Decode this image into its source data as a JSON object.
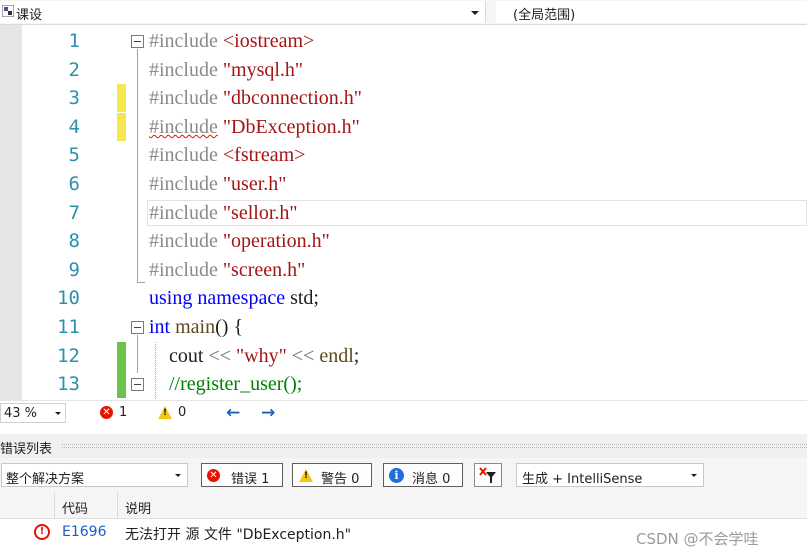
{
  "navbar": {
    "project": "课设",
    "scope": "(全局范围)"
  },
  "editor": {
    "lines": [
      {
        "num": "1",
        "parts": [
          {
            "t": "#include ",
            "c": "pp"
          },
          {
            "t": "<iostream>",
            "c": "str"
          }
        ]
      },
      {
        "num": "2",
        "parts": [
          {
            "t": "#include ",
            "c": "pp"
          },
          {
            "t": "\"mysql.h\"",
            "c": "str"
          }
        ]
      },
      {
        "num": "3",
        "parts": [
          {
            "t": "#include ",
            "c": "pp"
          },
          {
            "t": "\"dbconnection.h\"",
            "c": "str"
          }
        ]
      },
      {
        "num": "4",
        "parts": [
          {
            "t": "#include",
            "c": "pp squiggle"
          },
          {
            "t": " ",
            "c": "pp"
          },
          {
            "t": "\"DbException.h\"",
            "c": "str"
          }
        ]
      },
      {
        "num": "5",
        "parts": [
          {
            "t": "#include ",
            "c": "pp"
          },
          {
            "t": "<fstream>",
            "c": "str"
          }
        ]
      },
      {
        "num": "6",
        "parts": [
          {
            "t": "#include ",
            "c": "pp"
          },
          {
            "t": "\"user.h\"",
            "c": "str"
          }
        ]
      },
      {
        "num": "7",
        "parts": [
          {
            "t": "#include ",
            "c": "pp"
          },
          {
            "t": "\"sellor.h\"",
            "c": "str"
          }
        ]
      },
      {
        "num": "8",
        "parts": [
          {
            "t": "#include ",
            "c": "pp"
          },
          {
            "t": "\"operation.h\"",
            "c": "str"
          }
        ]
      },
      {
        "num": "9",
        "parts": [
          {
            "t": "#include ",
            "c": "pp"
          },
          {
            "t": "\"screen.h\"",
            "c": "str"
          }
        ]
      },
      {
        "num": "10",
        "parts": [
          {
            "t": "using",
            "c": "kw"
          },
          {
            "t": " ",
            "c": ""
          },
          {
            "t": "namespace",
            "c": "kw"
          },
          {
            "t": " std;",
            "c": ""
          }
        ]
      },
      {
        "num": "11",
        "parts": [
          {
            "t": "int",
            "c": "kw"
          },
          {
            "t": " ",
            "c": ""
          },
          {
            "t": "main",
            "c": "fn"
          },
          {
            "t": "() {",
            "c": ""
          }
        ]
      },
      {
        "num": "12",
        "parts": [
          {
            "t": "    cout ",
            "c": ""
          },
          {
            "t": "<<",
            "c": "op"
          },
          {
            "t": " ",
            "c": ""
          },
          {
            "t": "\"why\"",
            "c": "str"
          },
          {
            "t": " ",
            "c": ""
          },
          {
            "t": "<<",
            "c": "op"
          },
          {
            "t": " ",
            "c": ""
          },
          {
            "t": "endl",
            "c": "fn"
          },
          {
            "t": ";",
            "c": ""
          }
        ]
      },
      {
        "num": "13",
        "parts": [
          {
            "t": "    ",
            "c": ""
          },
          {
            "t": "//register_user();",
            "c": "cm"
          }
        ]
      }
    ]
  },
  "status": {
    "zoom": "43 %",
    "errors": "1",
    "warnings": "0"
  },
  "error_list": {
    "title": "错误列表",
    "scope": "整个解决方案",
    "errors_btn": "错误 1",
    "warnings_btn": "警告 0",
    "messages_btn": "消息 0",
    "source": "生成 + IntelliSense",
    "col_code": "代码",
    "col_desc": "说明",
    "row": {
      "code": "E1696",
      "description": "无法打开 源 文件 \"DbException.h\""
    }
  },
  "watermark": "CSDN @不会学哇",
  "colors": {
    "line_number": "#2b91af",
    "string": "#a31515",
    "keyword": "#0000ff",
    "error": "#e51400",
    "saved_change": "#6cc24a",
    "unsaved_change": "#f5e84f"
  }
}
